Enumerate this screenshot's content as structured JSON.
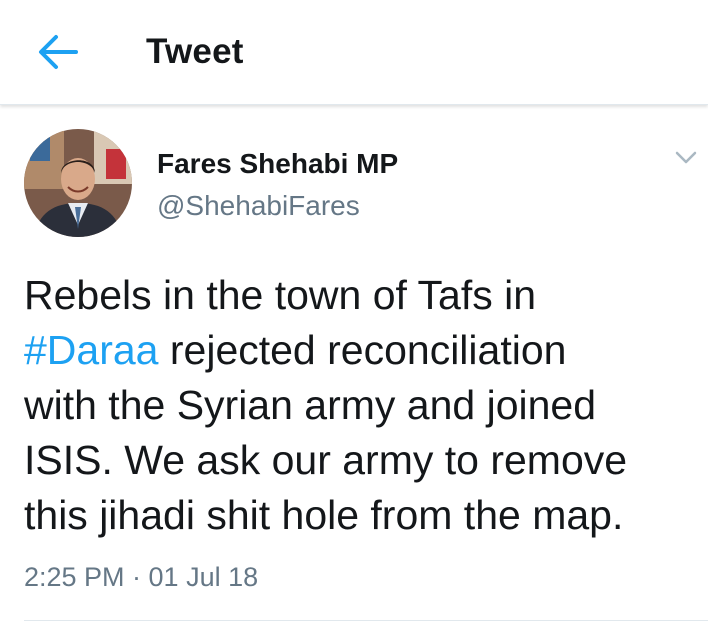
{
  "header": {
    "title": "Tweet",
    "back_icon": "arrow-left-icon"
  },
  "colors": {
    "accent": "#1da1f2",
    "text": "#14171a",
    "secondary_text": "#657786"
  },
  "tweet": {
    "author_name": "Fares Shehabi MP",
    "author_handle": "@ShehabiFares",
    "menu_icon": "chevron-down-icon",
    "text_lines": {
      "line1": "Rebels in the town of Tafs in",
      "line2_hashtag": "#Daraa",
      "line2_rest": " rejected reconciliation",
      "line3": "with the Syrian army and joined",
      "line4": "ISIS. We ask our army to remove",
      "line5": "this jihadi shit hole from the map."
    },
    "timestamp": "2:25 PM · 01 Jul 18"
  }
}
